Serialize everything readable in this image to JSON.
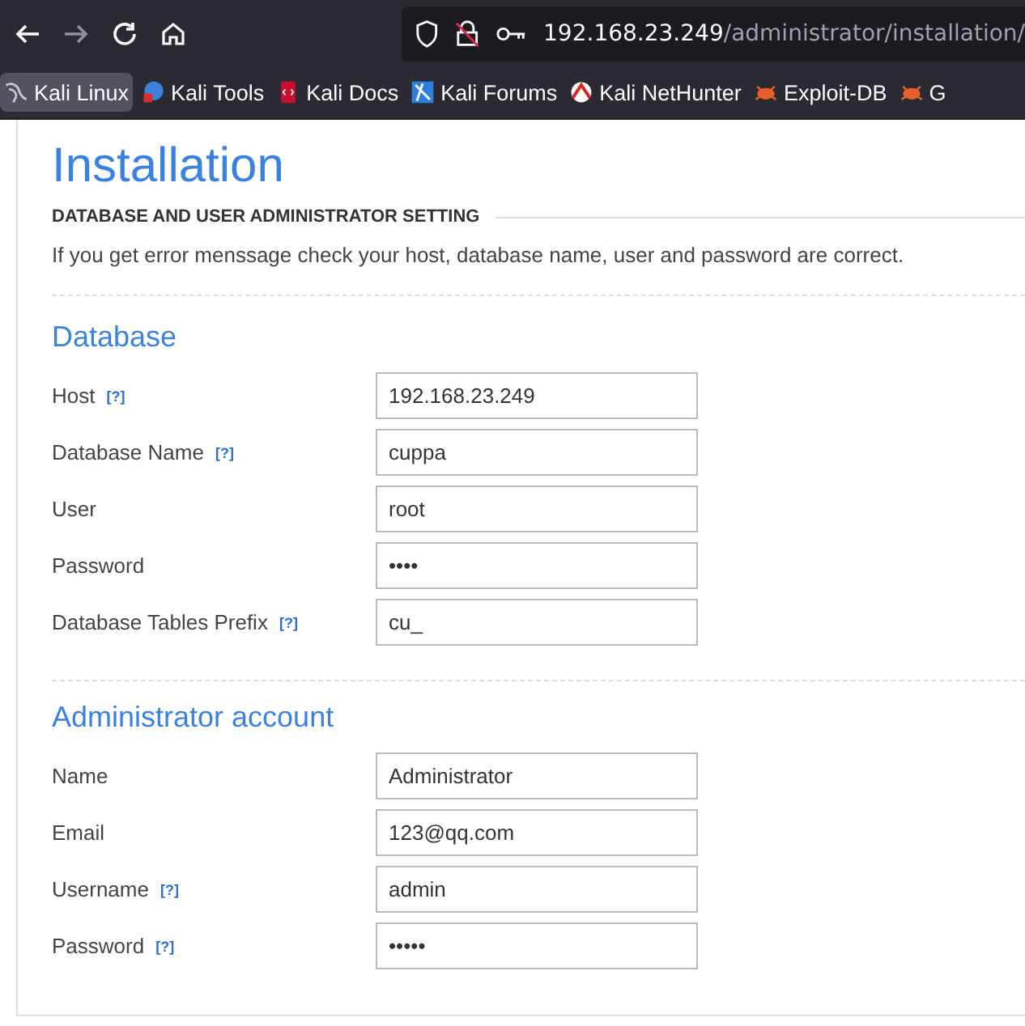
{
  "browser": {
    "url_host": "192.168.23.249",
    "url_path": "/administrator/installation/",
    "bookmarks": [
      {
        "label": "Kali Linux",
        "selected": true,
        "kind": "dragon"
      },
      {
        "label": "Kali Tools",
        "selected": false,
        "kind": "tools"
      },
      {
        "label": "Kali Docs",
        "selected": false,
        "kind": "docs"
      },
      {
        "label": "Kali Forums",
        "selected": false,
        "kind": "forums"
      },
      {
        "label": "Kali NetHunter",
        "selected": false,
        "kind": "nethunter"
      },
      {
        "label": "Exploit-DB",
        "selected": false,
        "kind": "bug"
      },
      {
        "label": "G",
        "selected": false,
        "kind": "bug"
      }
    ]
  },
  "page": {
    "title": "Installation",
    "subtitle": "DATABASE AND USER ADMINISTRATOR SETTING",
    "note": "If you get error menssage check your host, database name, user and password are correct.",
    "sections": [
      {
        "title": "Database",
        "fields": [
          {
            "label": "Host",
            "help": "[?]",
            "value": "192.168.23.249"
          },
          {
            "label": "Database Name",
            "help": "[?]",
            "value": "cuppa"
          },
          {
            "label": "User",
            "value": "root"
          },
          {
            "label": "Password",
            "value": "••••"
          },
          {
            "label": "Database Tables Prefix",
            "help": "[?]",
            "value": "cu_"
          }
        ]
      },
      {
        "title": "Administrator account",
        "fields": [
          {
            "label": "Name",
            "value": "Administrator"
          },
          {
            "label": "Email",
            "value": "123@qq.com"
          },
          {
            "label": "Username",
            "help": "[?]",
            "value": "admin"
          },
          {
            "label": "Password",
            "help": "[?]",
            "value": "•••••"
          }
        ]
      }
    ]
  }
}
